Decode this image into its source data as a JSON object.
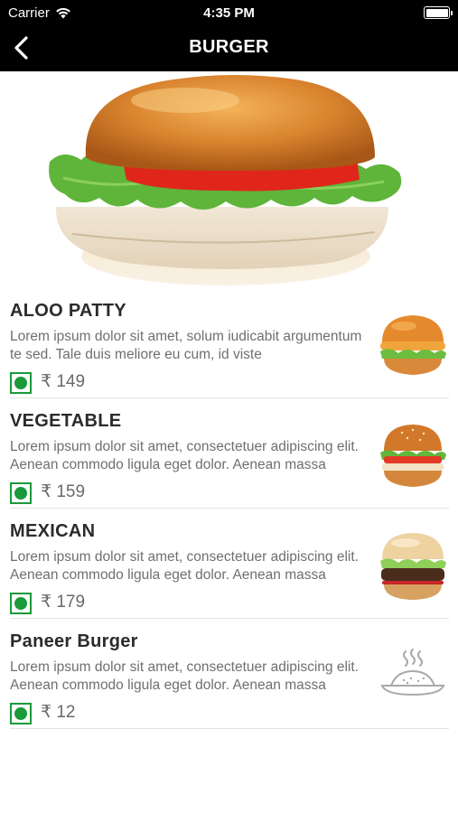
{
  "status_bar": {
    "carrier": "Carrier",
    "time": "4:35 PM"
  },
  "nav": {
    "title": "BURGER"
  },
  "hero": {
    "icon": "burger-hero-image"
  },
  "colors": {
    "veg_green": "#1a9a3a",
    "nav_bg": "#000000"
  },
  "items": [
    {
      "name": "ALOO PATTY",
      "desc": "Lorem ipsum dolor sit amet, solum iudicabit argumentum te sed. Tale duis meliore eu cum, id viste",
      "price": "₹ 149",
      "thumb": "aloo-patty-burger"
    },
    {
      "name": "VEGETABLE",
      "desc": "Lorem ipsum dolor sit amet, consectetuer adipiscing elit. Aenean commodo ligula eget dolor. Aenean massa",
      "price": "₹ 159",
      "thumb": "vegetable-burger"
    },
    {
      "name": "MEXICAN",
      "desc": "Lorem ipsum dolor sit amet, consectetuer adipiscing elit. Aenean commodo ligula eget dolor. Aenean massa",
      "price": "₹ 179",
      "thumb": "mexican-burger"
    },
    {
      "name": "Paneer Burger",
      "desc": "Lorem ipsum dolor sit amet, consectetuer adipiscing elit. Aenean commodo ligula eget dolor. Aenean massa",
      "price": "₹ 12",
      "thumb": "food-placeholder"
    }
  ]
}
